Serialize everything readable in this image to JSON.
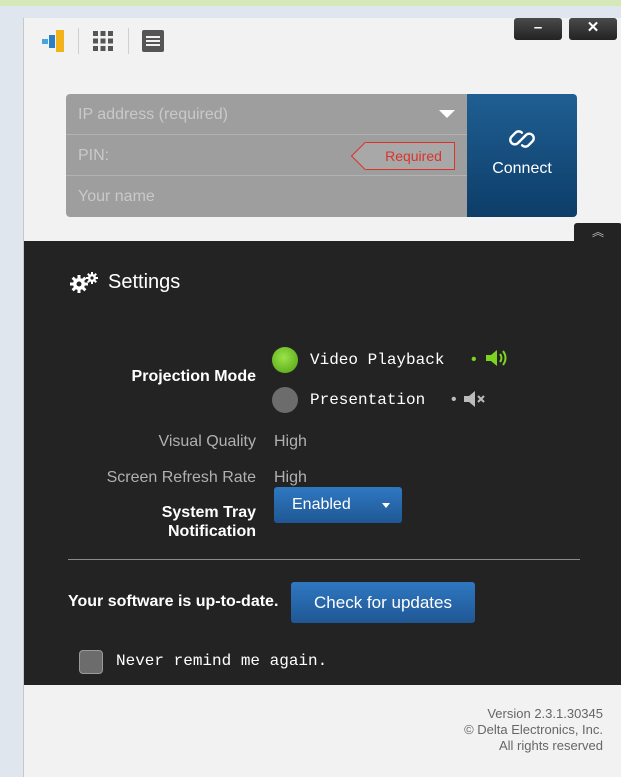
{
  "connection": {
    "ip_placeholder": "IP address (required)",
    "pin_placeholder": "PIN:",
    "pin_required_tag": "Required",
    "name_placeholder": "Your name",
    "connect_label": "Connect"
  },
  "window_controls": {
    "minimize": "–",
    "close": "✕"
  },
  "settings": {
    "title": "Settings",
    "projection_mode_label": "Projection Mode",
    "projection_options": [
      "Video Playback",
      "Presentation"
    ],
    "dot": "•",
    "visual_quality_label": "Visual Quality",
    "visual_quality_value": "High",
    "screen_refresh_label": "Screen Refresh Rate",
    "screen_refresh_value": "High",
    "system_tray_label_line1": "System Tray",
    "system_tray_label_line2": "Notification",
    "system_tray_value": "Enabled",
    "update_status": "Your software is up-to-date.",
    "check_updates_label": "Check for updates",
    "never_remind_label": "Never remind me again."
  },
  "footer": {
    "version": "Version 2.3.1.30345",
    "company": "© Delta Electronics, Inc.",
    "rights": "All rights reserved"
  },
  "colors": {
    "accent_blue": "#1f5f93",
    "active_green": "#7ed321",
    "required_red": "#d9342b",
    "panel_dark": "#232323"
  }
}
